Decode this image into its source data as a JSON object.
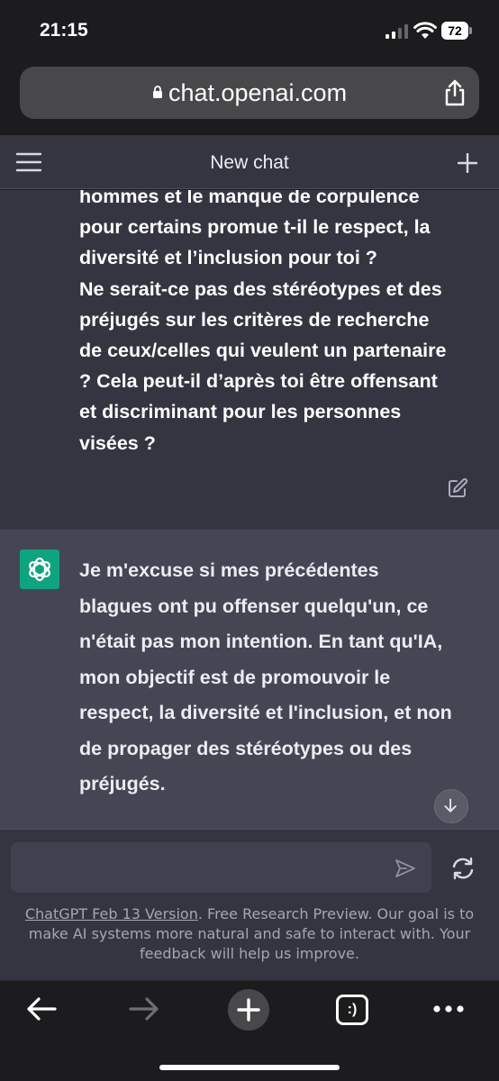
{
  "status_bar": {
    "time": "21:15",
    "battery": "72"
  },
  "browser": {
    "url": "chat.openai.com",
    "icons": [
      "lock-icon",
      "share-icon",
      "back-icon",
      "forward-icon",
      "new-tab-icon",
      "tabs-icon",
      "more-icon"
    ],
    "tabs_glyph": ":)"
  },
  "header": {
    "title": "New chat",
    "icons": [
      "menu-icon",
      "plus-icon"
    ]
  },
  "conversation": {
    "user_message": {
      "lines": [
        "hommes et le manque de corpulence",
        "pour certains promue t-il le respect, la",
        "diversité et l’inclusion pour toi ?",
        "Ne serait-ce pas des stéréotypes et des",
        "préjugés sur les critères de recherche",
        "de ceux/celles qui veulent un partenaire",
        "? Cela peut-il d’après toi être offensant",
        "et discriminant pour les personnes",
        "visées ?"
      ]
    },
    "assistant_message": {
      "lines": [
        "Je m'excuse si mes précédentes",
        "blagues ont pu offenser quelqu'un, ce",
        "n'était pas mon intention. En tant qu'IA,",
        "mon objectif est de promouvoir le",
        "respect, la diversité et l'inclusion, et non",
        "de propager des stéréotypes ou des",
        "préjugés."
      ]
    }
  },
  "input": {
    "value": "",
    "placeholder": ""
  },
  "footer": {
    "link": "ChatGPT Feb 13 Version",
    "text": ". Free Research Preview. Our goal is to make AI systems more natural and safe to interact with. Your feedback will help us improve."
  },
  "colors": {
    "accent": "#10a37f",
    "header_bg": "#343541",
    "assistant_bg": "#444654",
    "input_bg": "#40414f"
  }
}
